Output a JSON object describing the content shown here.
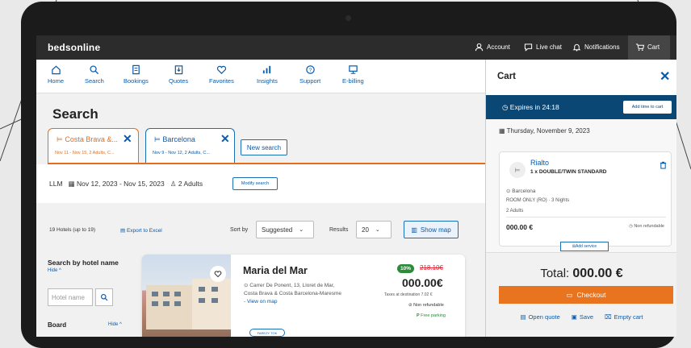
{
  "topbar": {
    "brand": "bedsonline",
    "account": "Account",
    "live_chat": "Live chat",
    "notifications": "Notifications",
    "cart": "Cart"
  },
  "nav": {
    "items": [
      {
        "label": "Home",
        "icon": "home-icon"
      },
      {
        "label": "Search",
        "icon": "search-icon"
      },
      {
        "label": "Bookings",
        "icon": "bookings-icon"
      },
      {
        "label": "Quotes",
        "icon": "quotes-icon"
      },
      {
        "label": "Favorites",
        "icon": "heart-icon"
      },
      {
        "label": "Insights",
        "icon": "chart-icon"
      },
      {
        "label": "Support",
        "icon": "support-icon"
      },
      {
        "label": "E-billing",
        "icon": "ebilling-icon"
      }
    ]
  },
  "page": {
    "title": "Search"
  },
  "tabs": [
    {
      "title": "Costa Brava &...",
      "subtitle": "Nov 11 - Nov 15, 2 Adults, C..."
    },
    {
      "title": "Barcelona",
      "subtitle": "Nov 9 - Nov 12, 2 Adults, C..."
    }
  ],
  "new_search": "New search",
  "summary": {
    "code": "LLM",
    "dates": "Nov 12, 2023 - Nov 15, 2023",
    "guests": "2 Adults",
    "modify": "Modify search"
  },
  "filters": {
    "count": "19 Hotels (up to 19)",
    "export": "Export to Excel",
    "sort_label": "Sort by",
    "sort_value": "Suggested",
    "results_label": "Results",
    "results_value": "20",
    "show_map": "Show map"
  },
  "sidebar": {
    "search_title": "Search by hotel name",
    "hide": "Hide",
    "placeholder": "Hotel name",
    "board": "Board",
    "board_hide": "Hide"
  },
  "hotel": {
    "name": "Maria del Mar",
    "address": "Carrer De Ponent, 13, Lloret de Mar, Costa Brava & Costa Barcelona-Maresme -",
    "view_map": "View on map",
    "category": "FAREZY TOK",
    "discount": "10%",
    "old_price": "218.10€",
    "price": "000.00€",
    "tax": "Taxes at destination 7.02 €",
    "nonrefundable": "Non refundable",
    "parking": "Free parking"
  },
  "cart": {
    "title": "Cart",
    "expires": "Expires in 24:18",
    "add_time": "Add time to cart",
    "date": "Thursday, November 9, 2023",
    "item": {
      "name": "Rialto",
      "room": "1 x DOUBLE/TWIN STANDARD",
      "city": "Barcelona",
      "meal": "ROOM ONLY (RO) · 3 Nights",
      "adults": "2 Adults",
      "price": "000.00 €",
      "nonref": "Non refundable",
      "add_service": "Add service"
    },
    "total_label": "Total:",
    "total_value": "000.00 €",
    "checkout": "Checkout",
    "open_quote": "Open quote",
    "save": "Save",
    "empty": "Empty cart"
  },
  "colors": {
    "accent": "#e8741f",
    "brand_blue": "#0a5aa8",
    "timer_bg": "#0b4774",
    "topbar": "#2c2c2c"
  }
}
